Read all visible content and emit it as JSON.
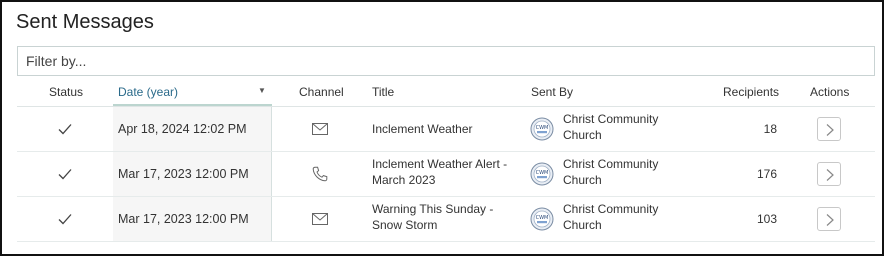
{
  "page": {
    "title": "Sent Messages"
  },
  "filter": {
    "placeholder": "Filter by...",
    "value": ""
  },
  "columns": {
    "status": "Status",
    "date": "Date (year)",
    "channel": "Channel",
    "title": "Title",
    "sent_by": "Sent By",
    "recipients": "Recipients",
    "actions": "Actions"
  },
  "sort": {
    "column": "date",
    "direction": "desc",
    "icon": "caret-down-icon"
  },
  "avatar_logo_text": "CWM",
  "rows": [
    {
      "status_icon": "check-icon",
      "date": "Apr 18, 2024 12:02 PM",
      "channel": "email",
      "channel_icon": "envelope-icon",
      "title": "Inclement Weather",
      "sent_by": "Christ Community Church",
      "recipients": "18"
    },
    {
      "status_icon": "check-icon",
      "date": "Mar 17, 2023 12:00 PM",
      "channel": "phone",
      "channel_icon": "phone-icon",
      "title": "Inclement Weather Alert - March 2023",
      "sent_by": "Christ Community Church",
      "recipients": "176"
    },
    {
      "status_icon": "check-icon",
      "date": "Mar 17, 2023 12:00 PM",
      "channel": "email",
      "channel_icon": "envelope-icon",
      "title": "Warning This Sunday - Snow Storm",
      "sent_by": "Christ Community Church",
      "recipients": "103"
    }
  ],
  "colors": {
    "accent": "#2a6a8a",
    "sorted_col_bg": "#f6f6f6",
    "border": "#c9d3d3"
  }
}
